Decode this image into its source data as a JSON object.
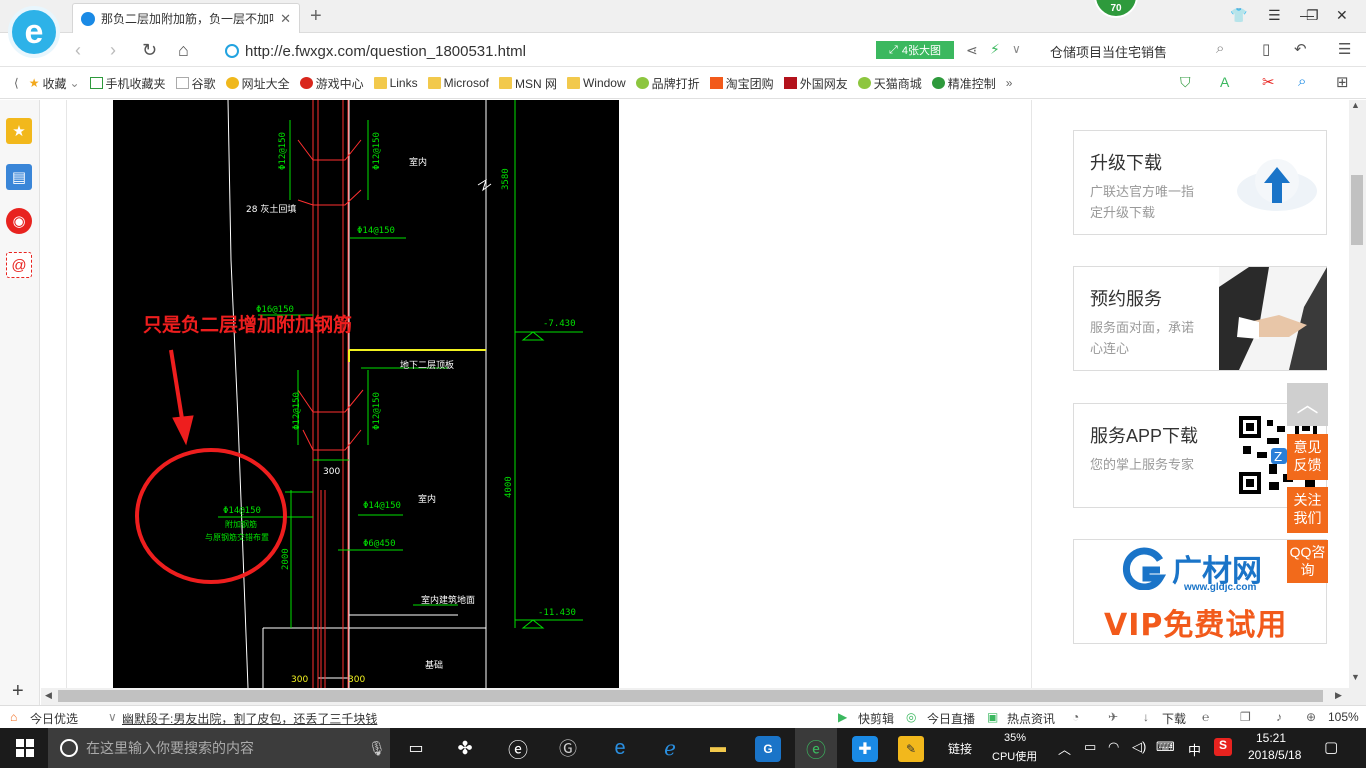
{
  "tab": {
    "title": "那负二层加附加筋，负一层不加吗"
  },
  "badge": "70",
  "address": {
    "url": "http://e.fwxgx.com/question_1800531.html",
    "big_image_label": "4张大图",
    "search_text": "仓储项目当住宅销售"
  },
  "bookmarks": [
    "收藏",
    "手机收藏夹",
    "谷歌",
    "网址大全",
    "游戏中心",
    "Links",
    "Microsof",
    "MSN 网",
    "Window",
    "品牌打折",
    "淘宝团购",
    "外国网友",
    "天猫商城",
    "精准控制"
  ],
  "cad": {
    "annotation": "只是负二层增加附加钢筋",
    "labels": {
      "rebar_top_left": "Φ12@150",
      "rebar_top_right": "Φ12@150",
      "room_top": "室内",
      "dim_3580": "3580",
      "wall_28": "28 灰土回填",
      "rebar_14a": "Φ14@150",
      "rebar_16": "Φ16@150",
      "elev_7430": "-7.430",
      "slab_label": "地下二层顶板",
      "rebar_mid_left": "Φ12@150",
      "rebar_mid_right": "Φ12@150",
      "dim_300_mid": "300",
      "rebar_14_circle": "Φ14@150",
      "addbar_1": "附加钢筋",
      "addbar_2": "与原钢筋交错布置",
      "rebar_14b": "Φ14@150",
      "rebar_6": "Φ6@450",
      "room_mid": "室内",
      "dim_4000": "4000",
      "dim_2000": "2000",
      "floor_label": "室内建筑地面",
      "elev_11430": "-11.430",
      "base_label": "基础",
      "dim_300_a": "300",
      "dim_300_b": "300"
    }
  },
  "sidebar_cards": [
    {
      "title": "升级下载",
      "desc": "广联达官方唯一指定升级下载"
    },
    {
      "title": "预约服务",
      "desc": "服务面对面，承诺心连心"
    },
    {
      "title": "服务APP下载",
      "desc": "您的掌上服务专家"
    }
  ],
  "ad": {
    "brand": "广材网",
    "domain": "www.gldjc.com",
    "slogan": "VIP免费试用"
  },
  "float_buttons": [
    "意见反馈",
    "关注我们",
    "QQ咨询"
  ],
  "statusbar": {
    "today": "今日优选",
    "news": "幽默段子:男友出院，割了皮包，还丢了三千块钱",
    "quick_cut": "快剪辑",
    "live": "今日直播",
    "hot": "热点资讯",
    "download": "下载",
    "zoom": "105%"
  },
  "taskbar": {
    "search_placeholder": "在这里输入你要搜索的内容",
    "links": "链接",
    "cpu_pct": "35%",
    "cpu_label": "CPU使用",
    "ime": "中",
    "time": "15:21",
    "date": "2018/5/18"
  },
  "colors": {
    "accent": "#2db2e8",
    "float_orange": "#f26a1b",
    "cad_green": "#00e000",
    "cad_red": "#e8231f"
  }
}
